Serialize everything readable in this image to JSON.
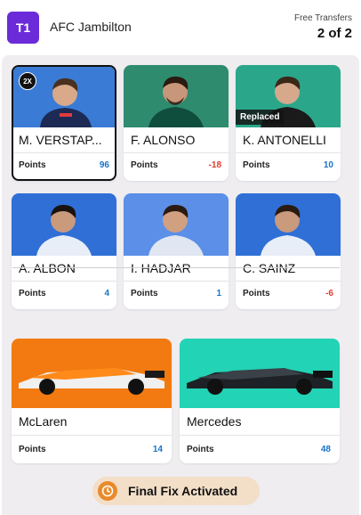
{
  "header": {
    "team_badge": "T1",
    "team_name": "AFC Jambilton",
    "free_transfers_label": "Free Transfers",
    "free_transfers_value": "2 of 2"
  },
  "points_label": "Points",
  "drivers": [
    {
      "name": "M. VERSTAP...",
      "points": "96",
      "multiplier": "2X",
      "bg": "#3a7bd5"
    },
    {
      "name": "F. ALONSO",
      "points": "-18",
      "bg": "#2e8b6e"
    },
    {
      "name": "K. ANTONELLI",
      "points": "10",
      "tag": "Replaced",
      "bg": "#2aa78a"
    },
    {
      "name": "A. ALBON",
      "points": "4",
      "bg": "#2f6fd6"
    },
    {
      "name": "I. HADJAR",
      "points": "1",
      "bg": "#5b8fe8"
    },
    {
      "name": "C. SAINZ",
      "points": "-6",
      "bg": "#2f6fd6"
    }
  ],
  "constructors": [
    {
      "name": "McLaren",
      "points": "14",
      "bg": "#f27a10"
    },
    {
      "name": "Mercedes",
      "points": "48",
      "bg": "#22d3b5"
    }
  ],
  "chip": {
    "label": "Final Fix Activated",
    "icon": "clock-icon"
  },
  "colors": {
    "positive": "#1a73c8",
    "negative": "#e03a2f",
    "chip_bg": "#f3dec8",
    "chip_icon": "#e98a2a",
    "team_badge": "#6c2bd9"
  }
}
